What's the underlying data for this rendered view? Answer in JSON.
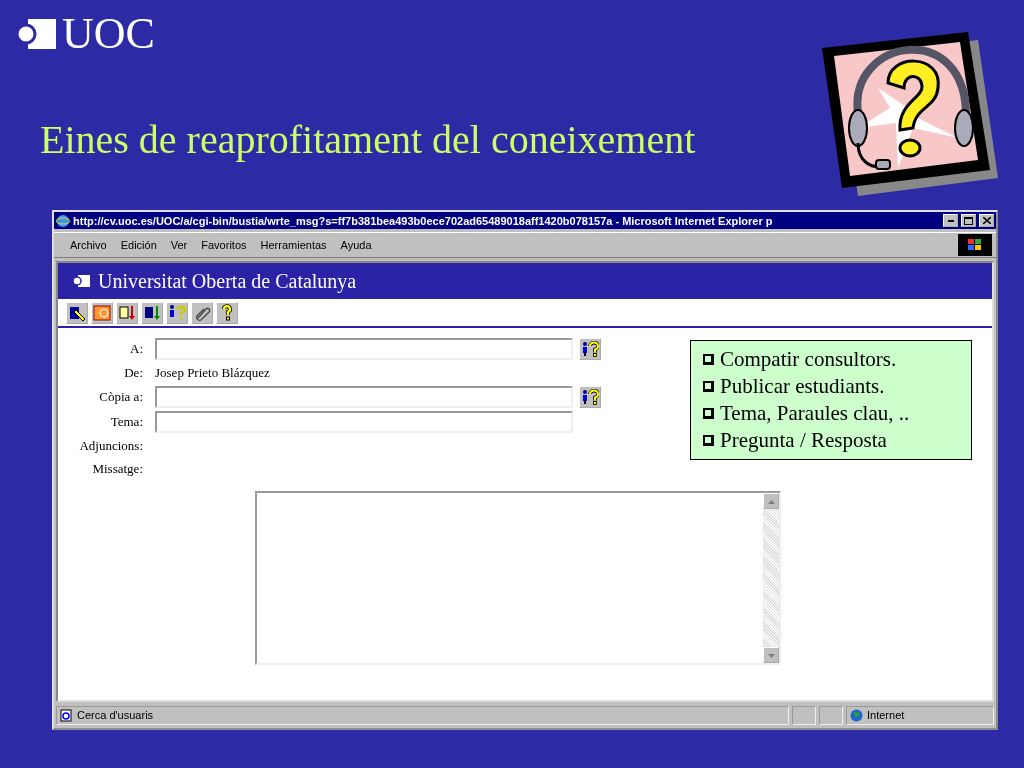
{
  "slide": {
    "logo": "UOC",
    "title": "Eines de reaprofitament del coneixement"
  },
  "browser": {
    "title": "http://cv.uoc.es/UOC/a/cgi-bin/bustia/wrte_msg?s=ff7b381bea493b0ece702ad65489018aff1420b078157a - Microsoft Internet Explorer p",
    "menu": [
      "Archivo",
      "Edición",
      "Ver",
      "Favoritos",
      "Herramientas",
      "Ayuda"
    ],
    "banner": "Universitat Oberta de Catalunya",
    "fields": [
      {
        "label": "A:",
        "kind": "input",
        "lookup": true
      },
      {
        "label": "De:",
        "kind": "text",
        "value": "Josep Prieto Blázquez"
      },
      {
        "label": "Còpia a:",
        "kind": "input",
        "lookup": true
      },
      {
        "label": "Tema:",
        "kind": "input",
        "lookup": false
      },
      {
        "label": "Adjuncions:",
        "kind": "none"
      },
      {
        "label": "Missatge:",
        "kind": "none"
      }
    ],
    "status_bar": {
      "text": "Cerca d'usuaris",
      "zone": "Internet"
    }
  },
  "note": {
    "items": [
      "Compatir consultors.",
      "Publicar estudiants.",
      "Tema, Paraules clau, ..",
      "Pregunta / Resposta"
    ]
  }
}
